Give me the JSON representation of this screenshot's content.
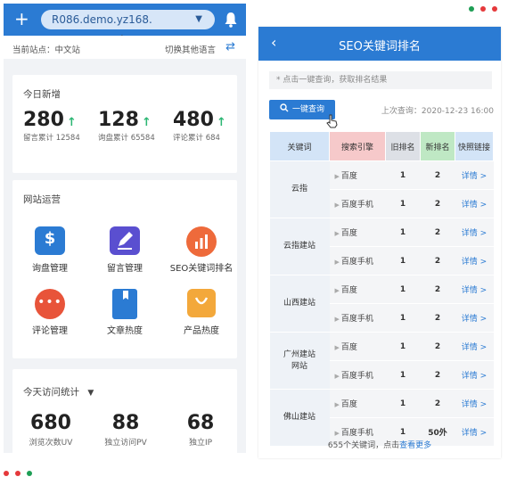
{
  "colors": {
    "primary": "#2b7bd3",
    "green": "#2bb673",
    "red": "#e5393b",
    "dotGreen": "#1e9e55"
  },
  "left": {
    "topbar": {
      "plus": "+",
      "domain": "R086.demo.yz168.",
      "caret": "▼"
    },
    "sitebar": {
      "current": "当前站点：中文站",
      "switch": "切换其他语言",
      "swap_icon": "⇄"
    },
    "today": {
      "title": "今日新增",
      "stats": [
        {
          "num": "280",
          "sub": "留言累计 12584"
        },
        {
          "num": "128",
          "sub": "询盘累计 65584"
        },
        {
          "num": "480",
          "sub": "评论累计 684"
        }
      ],
      "arrow": "↑"
    },
    "ops": {
      "title": "网站运营",
      "tiles": [
        {
          "label": "询盘管理",
          "icon": "dollar-icon"
        },
        {
          "label": "留言管理",
          "icon": "edit-icon"
        },
        {
          "label": "SEO关键词排名",
          "icon": "bar-chart-icon"
        },
        {
          "label": "评论管理",
          "icon": "chat-icon"
        },
        {
          "label": "文章热度",
          "icon": "book-icon"
        },
        {
          "label": "产品热度",
          "icon": "bag-icon"
        }
      ]
    },
    "visits": {
      "title": "今天访问统计",
      "caret": "▼",
      "stats": [
        {
          "num": "680",
          "sub": "浏览次数UV"
        },
        {
          "num": "88",
          "sub": "独立访问PV"
        },
        {
          "num": "68",
          "sub": "独立IP"
        }
      ]
    }
  },
  "right": {
    "header": {
      "back": "‹",
      "title": "SEO关键词排名"
    },
    "hint": "* 点击一键查询，获取排名结果",
    "query_button": "一键查询",
    "last_query": "上次查询：2020-12-23 16:00",
    "table": {
      "headers": [
        "关键词",
        "搜索引擎",
        "旧排名",
        "新排名",
        "快照链接"
      ],
      "groups": [
        {
          "keyword": "云指",
          "rows": [
            [
              "百度",
              "1",
              "2",
              "详情 >"
            ],
            [
              "百度手机",
              "1",
              "2",
              "详情 >"
            ]
          ]
        },
        {
          "keyword": "云指建站",
          "rows": [
            [
              "百度",
              "1",
              "2",
              "详情 >"
            ],
            [
              "百度手机",
              "1",
              "2",
              "详情 >"
            ]
          ]
        },
        {
          "keyword": "山西建站",
          "rows": [
            [
              "百度",
              "1",
              "2",
              "详情 >"
            ],
            [
              "百度手机",
              "1",
              "2",
              "详情 >"
            ]
          ]
        },
        {
          "keyword": "广州建站网站",
          "rows": [
            [
              "百度",
              "1",
              "2",
              "详情 >"
            ],
            [
              "百度手机",
              "1",
              "2",
              "详情 >"
            ]
          ]
        },
        {
          "keyword": "佛山建站",
          "rows": [
            [
              "百度",
              "1",
              "2",
              "详情 >"
            ],
            [
              "百度手机",
              "1",
              "50外",
              "详情 >"
            ]
          ]
        }
      ]
    },
    "footer_text": "655个关键词，点击",
    "footer_link": "查看更多"
  }
}
